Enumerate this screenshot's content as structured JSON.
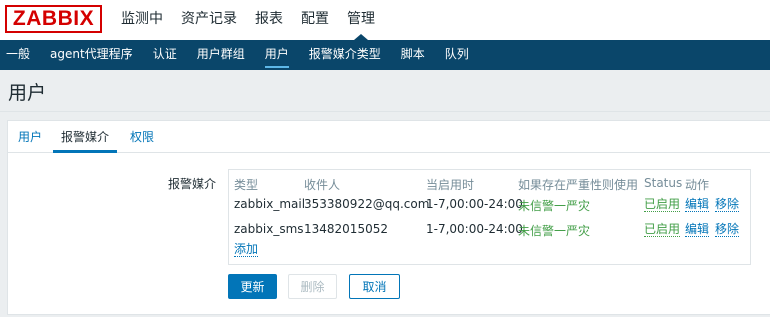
{
  "logo": "ZABBIX",
  "main_menu": [
    "监测中",
    "资产记录",
    "报表",
    "配置",
    "管理"
  ],
  "sub_menu": [
    "一般",
    "agent代理程序",
    "认证",
    "用户群组",
    "用户",
    "报警媒介类型",
    "脚本",
    "队列"
  ],
  "page_title": "用户",
  "tabs": [
    "用户",
    "报警媒介",
    "权限"
  ],
  "media": {
    "label": "报警媒介",
    "headers": {
      "type": "类型",
      "recipient": "收件人",
      "when_active": "当启用时",
      "severity": "如果存在严重性则使用",
      "status": "Status",
      "action": "动作"
    },
    "rows": [
      {
        "type": "zabbix_mail",
        "recipient": "353380922@qq.com",
        "when_active": "1-7,00:00-24:00",
        "severity": "未信警一严灾",
        "status": "已启用",
        "edit": "编辑",
        "remove": "移除"
      },
      {
        "type": "zabbix_sms",
        "recipient": "13482015052",
        "when_active": "1-7,00:00-24:00",
        "severity": "未信警一严灾",
        "status": "已启用",
        "edit": "编辑",
        "remove": "移除"
      }
    ],
    "add": "添加"
  },
  "buttons": {
    "update": "更新",
    "delete": "删除",
    "cancel": "取消"
  }
}
